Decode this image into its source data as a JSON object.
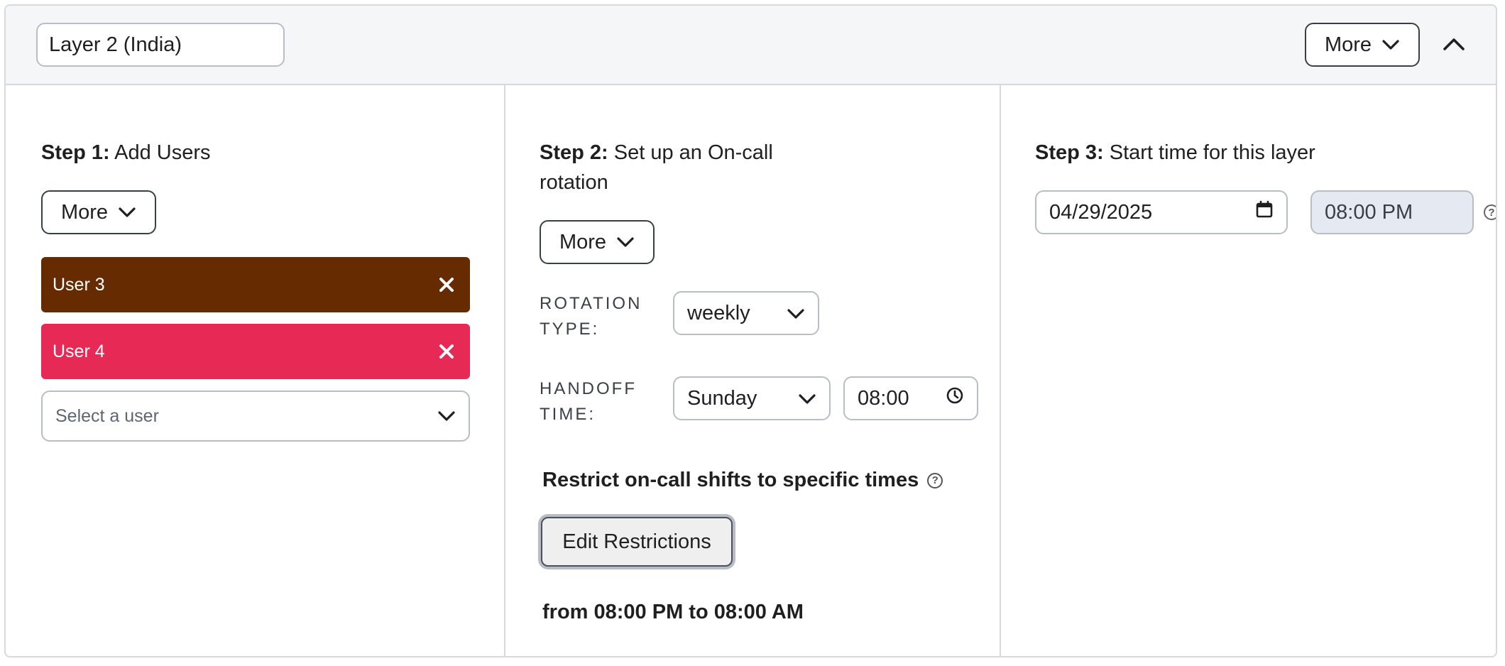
{
  "header": {
    "layer_name": "Layer 2 (India)",
    "more_label": "More"
  },
  "step1": {
    "title_bold": "Step 1:",
    "title_rest": " Add Users",
    "more_label": "More",
    "users": [
      {
        "name": "User 3",
        "color": "#662b00"
      },
      {
        "name": "User 4",
        "color": "#e72955"
      }
    ],
    "select_placeholder": "Select a user"
  },
  "step2": {
    "title_bold": "Step 2:",
    "title_line1": " Set up an On-call",
    "title_line2": "rotation",
    "more_label": "More",
    "rotation_type_line1": "ROTATION",
    "rotation_type_line2": "TYPE:",
    "rotation_type_value": "weekly",
    "handoff_line1": "HANDOFF",
    "handoff_line2": "TIME:",
    "handoff_day": "Sunday",
    "handoff_time": "08:00",
    "restrict_label": "Restrict on-call shifts to specific times",
    "help_glyph": "?",
    "edit_restrictions_label": "Edit Restrictions",
    "restriction_range": "from 08:00 PM to 08:00 AM"
  },
  "step3": {
    "title_bold": "Step 3:",
    "title_rest": " Start time for this layer",
    "start_date": "04/29/2025",
    "start_time": "08:00 PM",
    "help_glyph": "?"
  },
  "colors": {
    "user3": "#662b00",
    "user4": "#e72955",
    "time_field_bg": "#e4e9f2",
    "border": "#b9bdc4"
  },
  "icons": {
    "chevron": "chevron-down-icon",
    "collapse": "chevron-up-icon",
    "remove": "close-icon",
    "calendar": "calendar-icon",
    "clock": "clock-icon",
    "help": "question-circle-icon"
  }
}
